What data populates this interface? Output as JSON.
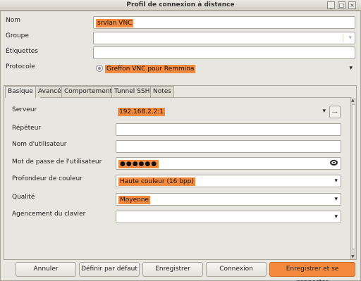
{
  "window": {
    "title": "Profil de connexion à distance"
  },
  "form": {
    "nom_label": "Nom",
    "nom_value": "srvlan VNC",
    "groupe_label": "Groupe",
    "etiquettes_label": "Étiquettes",
    "protocole_label": "Protocole",
    "protocole_value": "Greffon VNC pour Remmina"
  },
  "tabs": [
    {
      "label": "Basique"
    },
    {
      "label": "Avancé"
    },
    {
      "label": "Comportement"
    },
    {
      "label": "Tunnel SSH"
    },
    {
      "label": "Notes"
    }
  ],
  "basic": {
    "serveur_label": "Serveur",
    "serveur_value": "192.168.2.2:1",
    "repeteur_label": "Répéteur",
    "nom_utilisateur_label": "Nom d'utilisateur",
    "mot_de_passe_label": "Mot de passe de l'utilisateur",
    "mot_de_passe_value": "●●●●●●",
    "profondeur_label": "Profondeur de couleur",
    "profondeur_value": "Haute couleur (16 bpp)",
    "qualite_label": "Qualité",
    "qualite_value": "Moyenne",
    "agencement_label": "Agencement du clavier",
    "browse_label": "..."
  },
  "buttons": {
    "annuler": "Annuler",
    "definir_defaut": "Définir par défaut",
    "enregistrer": "Enregistrer",
    "connexion": "Connexion",
    "enregistrer_connecter": "Enregistrer et se connecter"
  },
  "colors": {
    "highlight": "#f38a3e"
  }
}
